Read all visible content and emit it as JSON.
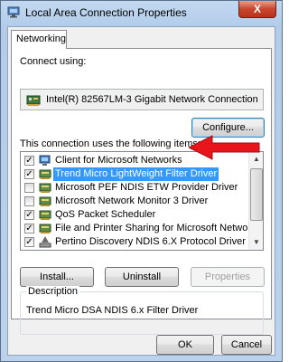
{
  "window": {
    "title": "Local Area Connection Properties",
    "close_glyph": "X"
  },
  "tabs": [
    {
      "label": "Networking",
      "active": true
    }
  ],
  "connect_using": {
    "label": "Connect using:",
    "adapter": "Intel(R) 82567LM-3 Gigabit Network Connection",
    "adapter_icon": "network-adapter-icon"
  },
  "buttons": {
    "configure": "Configure...",
    "install": "Install...",
    "uninstall": "Uninstall",
    "properties": "Properties",
    "ok": "OK",
    "cancel": "Cancel"
  },
  "items_label": "This connection uses the following items:",
  "items": [
    {
      "label": "Client for Microsoft Networks",
      "checked": true,
      "icon": "client-icon",
      "selected": false
    },
    {
      "label": "Trend Micro LightWeight Filter Driver",
      "checked": true,
      "icon": "network-service-icon",
      "selected": true
    },
    {
      "label": "Microsoft PEF NDIS ETW Provider Driver",
      "checked": false,
      "icon": "network-service-icon",
      "selected": false
    },
    {
      "label": "Microsoft Network Monitor 3 Driver",
      "checked": false,
      "icon": "network-service-icon",
      "selected": false
    },
    {
      "label": "QoS Packet Scheduler",
      "checked": true,
      "icon": "network-service-icon",
      "selected": false
    },
    {
      "label": "File and Printer Sharing for Microsoft Networks",
      "checked": true,
      "icon": "network-service-icon",
      "selected": false
    },
    {
      "label": "Pertino Discovery NDIS 6.X Protocol Driver",
      "checked": true,
      "icon": "protocol-icon",
      "selected": false
    }
  ],
  "description": {
    "legend": "Description",
    "text": "Trend Micro DSA NDIS 6.x Filter Driver"
  },
  "colors": {
    "selection": "#3399ff",
    "annotation_arrow": "#e8151b",
    "titlebar": "#b9d1ea"
  }
}
